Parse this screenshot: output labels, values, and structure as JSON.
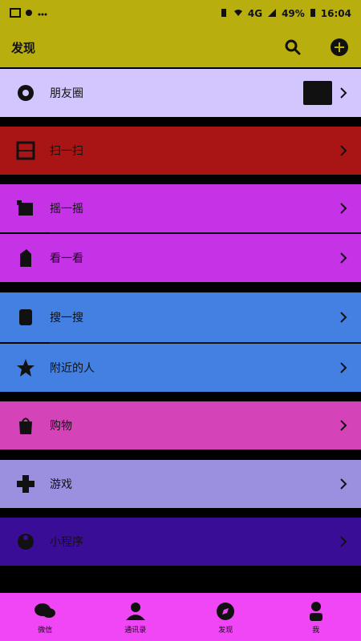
{
  "statusbar": {
    "time": "16:04",
    "battery": "49%",
    "signal": "4G"
  },
  "appbar": {
    "title": "发现"
  },
  "rows": [
    {
      "label": "朋友圈",
      "color": "#d3c6ff"
    },
    {
      "label": "扫一扫",
      "color": "#a81514"
    },
    {
      "label": "摇一摇",
      "color": "#c632e6"
    },
    {
      "label": "看一看",
      "color": "#c632e6"
    },
    {
      "label": "搜一搜",
      "color": "#4380e1"
    },
    {
      "label": "附近的人",
      "color": "#4380e1"
    },
    {
      "label": "购物",
      "color": "#d443b8"
    },
    {
      "label": "游戏",
      "color": "#9b90e0"
    },
    {
      "label": "小程序",
      "color": "#3a0d96"
    }
  ],
  "tabs": [
    {
      "label": "微信"
    },
    {
      "label": "通讯录"
    },
    {
      "label": "发现"
    },
    {
      "label": "我"
    }
  ]
}
